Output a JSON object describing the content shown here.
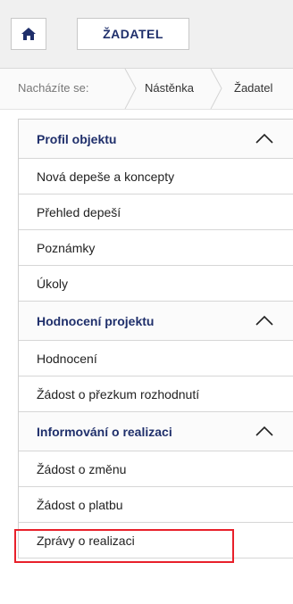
{
  "header": {
    "role_label": "ŽADATEL"
  },
  "breadcrumb": {
    "label": "Nacházíte se:",
    "items": [
      "Nástěnka",
      "Žadatel"
    ]
  },
  "menu": {
    "sections": [
      {
        "title": "Profil objektu",
        "items": [
          "Nová depeše a koncepty",
          "Přehled depeší",
          "Poznámky",
          "Úkoly"
        ]
      },
      {
        "title": "Hodnocení projektu",
        "items": [
          "Hodnocení",
          "Žádost o přezkum rozhodnutí"
        ]
      },
      {
        "title": "Informování o realizaci",
        "items": [
          "Žádost o změnu",
          "Žádost o platbu",
          "Zprávy o realizaci"
        ]
      }
    ]
  },
  "colors": {
    "accent": "#1f2f6b",
    "highlight": "#e8202a"
  },
  "icons": {
    "home": "home-icon",
    "collapse": "chevron-up-icon"
  }
}
